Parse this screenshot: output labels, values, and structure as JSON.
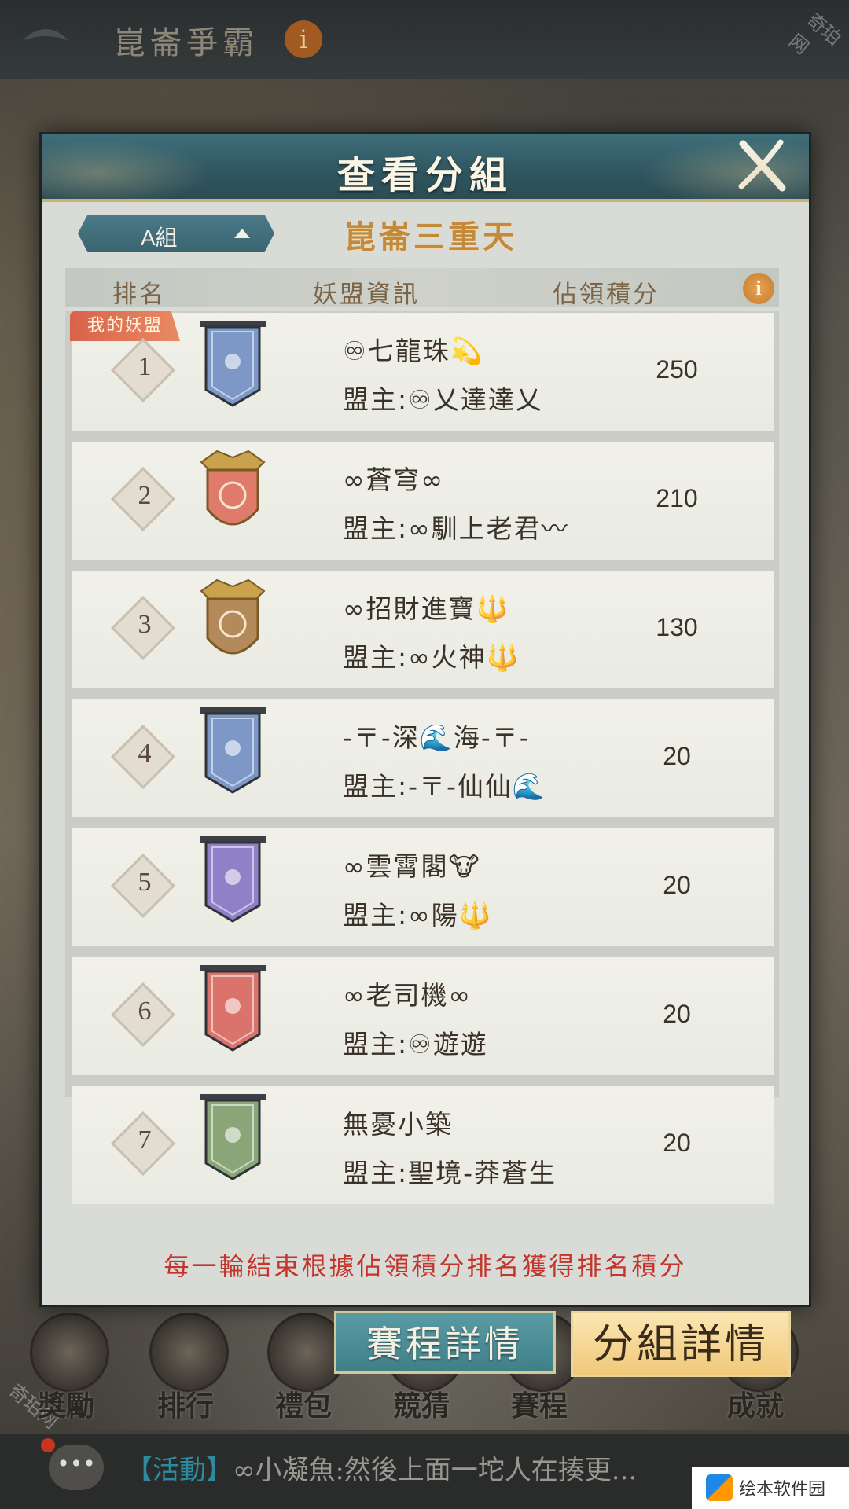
{
  "background": {
    "title": "崑崙爭霸",
    "info_glyph": "i",
    "watermark": "奇珀网",
    "nav": [
      {
        "label": "獎勵",
        "icon": "reward-icon"
      },
      {
        "label": "排行",
        "icon": "ranking-icon"
      },
      {
        "label": "禮包",
        "icon": "gift-icon"
      },
      {
        "label": "競猜",
        "icon": "guess-icon"
      },
      {
        "label": "賽程",
        "icon": "schedule-icon"
      },
      {
        "label": "成就",
        "icon": "achievement-icon"
      }
    ],
    "chat": {
      "tag": "【活動】",
      "message": "∞小凝魚:然後上面一坨人在揍更...",
      "icon": "chat-bubble-icon"
    },
    "brand": "绘本软件园"
  },
  "modal": {
    "title": "查看分組",
    "group_selector": "A組",
    "subtitle": "崑崙三重天",
    "headers": {
      "rank": "排名",
      "info": "妖盟資訊",
      "score": "佔領積分"
    },
    "my_tag": "我的妖盟",
    "rows": [
      {
        "rank": "1",
        "name": "♾七龍珠💫",
        "leader": "盟主:♾乂達達乂",
        "score": "250",
        "banner_color": "#7d98c6",
        "banner": "blue-banner-icon"
      },
      {
        "rank": "2",
        "name": "∞蒼穹∞",
        "leader": "盟主:∞馴上老君〰",
        "score": "210",
        "banner_color": "#e07a6b",
        "banner": "flame-crest-icon"
      },
      {
        "rank": "3",
        "name": "∞招財進寶🔱",
        "leader": "盟主:∞火神🔱",
        "score": "130",
        "banner_color": "#b48a5a",
        "banner": "tree-crest-icon"
      },
      {
        "rank": "4",
        "name": "-〒-深🌊海-〒-",
        "leader": "盟主:-〒-仙仙🌊",
        "score": "20",
        "banner_color": "#7d98c6",
        "banner": "blue-banner-icon"
      },
      {
        "rank": "5",
        "name": "∞雲霄閣🐮",
        "leader": "盟主:∞陽🔱",
        "score": "20",
        "banner_color": "#8f80c8",
        "banner": "purple-banner-icon"
      },
      {
        "rank": "6",
        "name": "∞老司機∞",
        "leader": "盟主:♾遊遊",
        "score": "20",
        "banner_color": "#d9736b",
        "banner": "red-banner-icon"
      },
      {
        "rank": "7",
        "name": "無憂小築",
        "leader": "盟主:聖境-莽蒼生",
        "score": "20",
        "banner_color": "#8aa678",
        "banner": "green-banner-icon"
      }
    ],
    "note": "每一輪結束根據佔領積分排名獲得排名積分"
  },
  "buttons": {
    "schedule": "賽程詳情",
    "group": "分組詳情"
  },
  "colors": {
    "header_teal": "#2f5560",
    "title_gold": "#c48a3c",
    "note_red": "#c2342c",
    "active_tab_gold": "#f0c879"
  }
}
